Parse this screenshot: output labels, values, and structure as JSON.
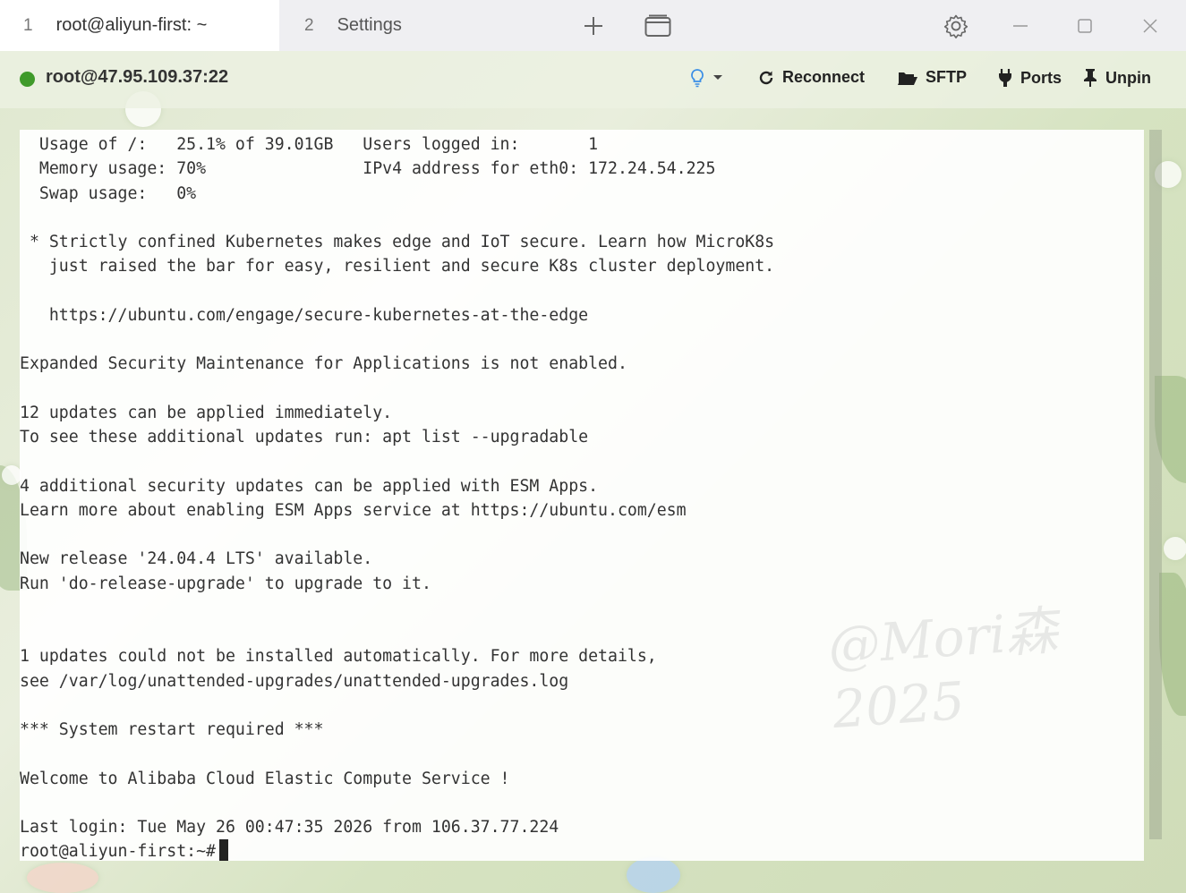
{
  "tabs": [
    {
      "number": "1",
      "title": "root@aliyun-first: ~"
    },
    {
      "number": "2",
      "title": "Settings"
    }
  ],
  "window_icons": [
    "plus-icon",
    "window-icon",
    "gear-icon",
    "minimize-icon",
    "maximize-icon",
    "close-icon"
  ],
  "session": {
    "status_color": "#3f9a2a",
    "host": "root@47.95.109.37:22",
    "actions": {
      "reconnect": "Reconnect",
      "sftp": "SFTP",
      "ports": "Ports",
      "unpin": "Unpin"
    }
  },
  "terminal": {
    "lines": [
      "  Usage of /:   25.1% of 39.01GB   Users logged in:       1",
      "  Memory usage: 70%                IPv4 address for eth0: 172.24.54.225",
      "  Swap usage:   0%",
      "",
      " * Strictly confined Kubernetes makes edge and IoT secure. Learn how MicroK8s",
      "   just raised the bar for easy, resilient and secure K8s cluster deployment.",
      "",
      "   https://ubuntu.com/engage/secure-kubernetes-at-the-edge",
      "",
      "Expanded Security Maintenance for Applications is not enabled.",
      "",
      "12 updates can be applied immediately.",
      "To see these additional updates run: apt list --upgradable",
      "",
      "4 additional security updates can be applied with ESM Apps.",
      "Learn more about enabling ESM Apps service at https://ubuntu.com/esm",
      "",
      "New release '24.04.4 LTS' available.",
      "Run 'do-release-upgrade' to upgrade to it.",
      "",
      "",
      "1 updates could not be installed automatically. For more details,",
      "see /var/log/unattended-upgrades/unattended-upgrades.log",
      "",
      "*** System restart required ***",
      "",
      "Welcome to Alibaba Cloud Elastic Compute Service !",
      "",
      "Last login: Tue May 26 00:47:35 2026 from 106.37.77.224"
    ],
    "prompt": "root@aliyun-first:~#"
  }
}
